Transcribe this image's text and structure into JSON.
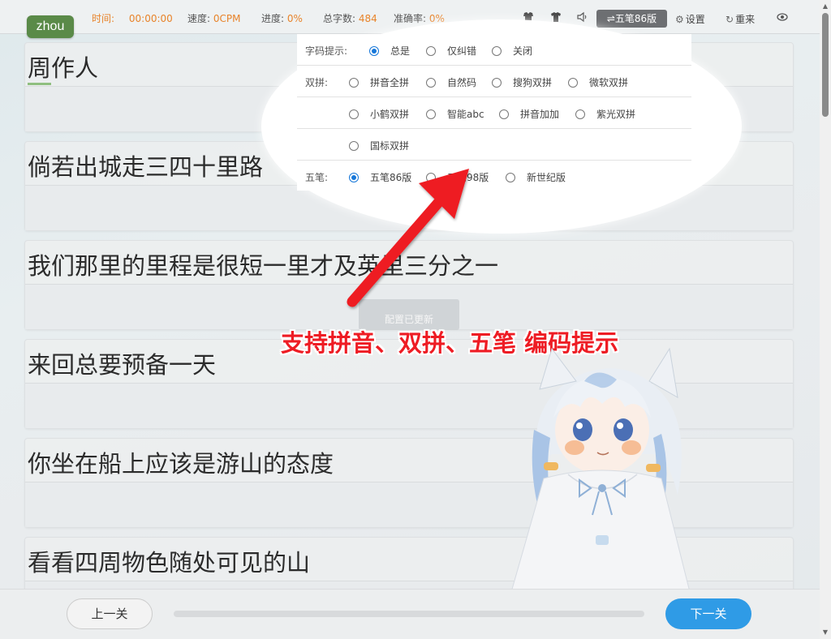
{
  "user": {
    "name": "zhou"
  },
  "stats": {
    "time_label": "时间:",
    "time_value": "00:00:00",
    "speed_label": "速度:",
    "speed_value": "0CPM",
    "progress_label": "进度:",
    "progress_value": "0%",
    "total_label": "总字数:",
    "total_value": "484",
    "accuracy_label": "准确率:",
    "accuracy_value": "0%"
  },
  "toolbar": {
    "mode_label": "⇌五笔86版",
    "settings_label": "设置",
    "restart_label": "重来",
    "icons": [
      "shirt-icon",
      "tshirt-icon",
      "volume-icon",
      "gear-icon",
      "refresh-icon",
      "theme-icon"
    ]
  },
  "lines": [
    {
      "text": "周作人"
    },
    {
      "text": "倘若出城走三四十里路"
    },
    {
      "text": "我们那里的里程是很短一里才及英里三分之一"
    },
    {
      "text": "来回总要预备一天"
    },
    {
      "text": "你坐在船上应该是游山的态度"
    },
    {
      "text": "看看四周物色随处可见的山"
    }
  ],
  "popup": {
    "hint": {
      "label": "字码提示:",
      "options": [
        {
          "label": "总是",
          "selected": true
        },
        {
          "label": "仅纠错",
          "selected": false
        },
        {
          "label": "关闭",
          "selected": false
        }
      ]
    },
    "shuangpin": {
      "label": "双拼:",
      "options_row1": [
        {
          "label": "拼音全拼",
          "selected": false
        },
        {
          "label": "自然码",
          "selected": false
        },
        {
          "label": "搜狗双拼",
          "selected": false
        },
        {
          "label": "微软双拼",
          "selected": false
        }
      ],
      "options_row2": [
        {
          "label": "小鹤双拼",
          "selected": false
        },
        {
          "label": "智能abc",
          "selected": false
        },
        {
          "label": "拼音加加",
          "selected": false
        },
        {
          "label": "紫光双拼",
          "selected": false
        }
      ],
      "options_row3": [
        {
          "label": "国标双拼",
          "selected": false
        }
      ]
    },
    "wubi": {
      "label": "五笔:",
      "options": [
        {
          "label": "五笔86版",
          "selected": true
        },
        {
          "label": "五笔98版",
          "selected": false
        },
        {
          "label": "新世纪版",
          "selected": false
        }
      ]
    }
  },
  "toast": {
    "text": "配置已更新"
  },
  "caption": {
    "text": "支持拼音、双拼、五笔 编码提示"
  },
  "bottom": {
    "prev_label": "上一关",
    "next_label": "下一关",
    "progress": 0
  },
  "colors": {
    "accent": "#2f9be6",
    "stat_value": "#e8832a",
    "badge": "#5a8a48",
    "caption": "#ee1c24",
    "radio_on": "#1677d9"
  }
}
